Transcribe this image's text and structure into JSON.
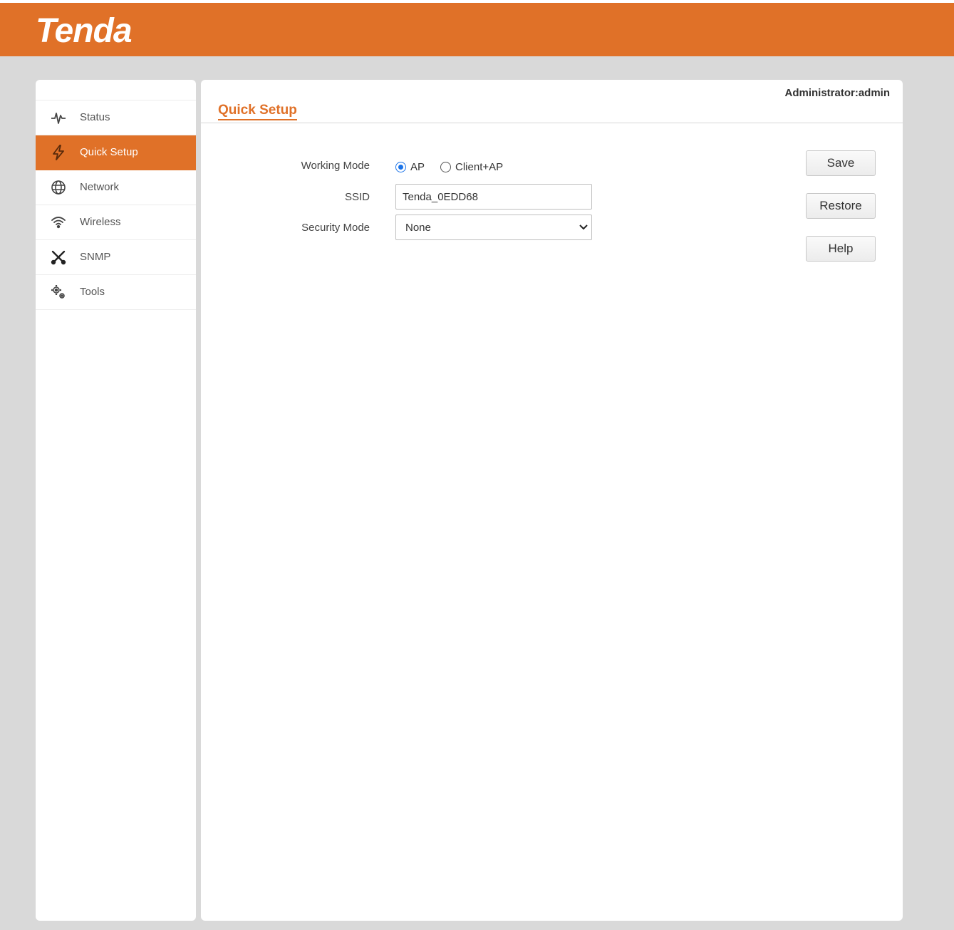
{
  "brand": {
    "logo_text": "Tenda",
    "accent_color": "#e07128"
  },
  "header": {
    "user": "Administrator:admin"
  },
  "sidebar": {
    "items": [
      {
        "label": "Status",
        "icon": "pulse-icon",
        "active": false
      },
      {
        "label": "Quick Setup",
        "icon": "lightning-icon",
        "active": true
      },
      {
        "label": "Network",
        "icon": "globe-icon",
        "active": false
      },
      {
        "label": "Wireless",
        "icon": "wifi-icon",
        "active": false
      },
      {
        "label": "SNMP",
        "icon": "tools-cross-icon",
        "active": false
      },
      {
        "label": "Tools",
        "icon": "gears-icon",
        "active": false
      }
    ]
  },
  "page": {
    "title": "Quick Setup"
  },
  "form": {
    "working_mode": {
      "label": "Working Mode",
      "options": [
        "AP",
        "Client+AP"
      ],
      "selected": "AP"
    },
    "ssid": {
      "label": "SSID",
      "value": "Tenda_0EDD68"
    },
    "security_mode": {
      "label": "Security Mode",
      "value": "None"
    }
  },
  "actions": {
    "save": "Save",
    "restore": "Restore",
    "help": "Help"
  }
}
